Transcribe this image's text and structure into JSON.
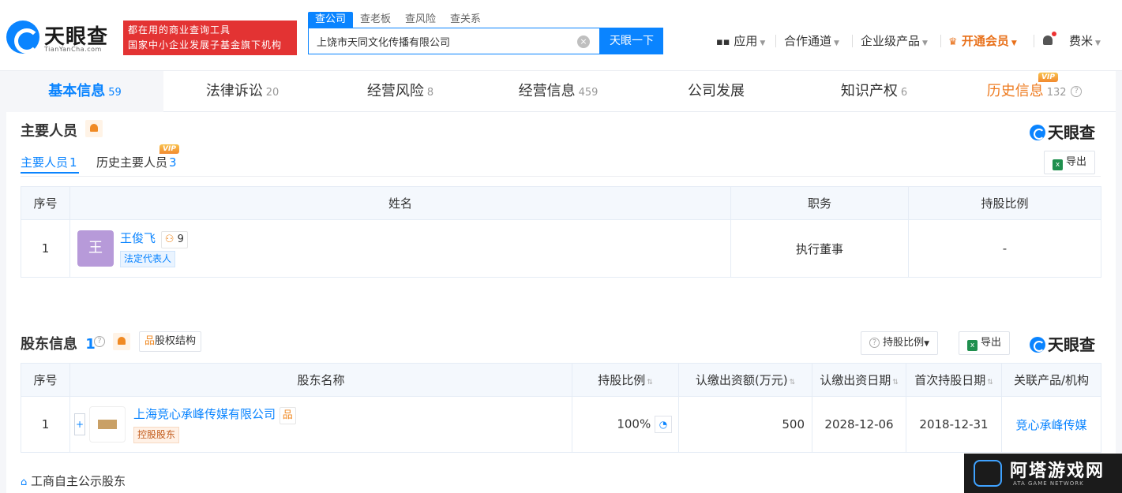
{
  "header": {
    "logo_text": "天眼查",
    "logo_sub": "TianYanCha.com",
    "slogan_line1": "都在用的商业查询工具",
    "slogan_line2": "国家中小企业发展子基金旗下机构",
    "search_tabs": [
      "查公司",
      "查老板",
      "查风险",
      "查关系"
    ],
    "search_value": "上饶市天同文化传播有限公司",
    "search_button": "天眼一下",
    "nav": {
      "apps": "应用",
      "channel": "合作通道",
      "enterprise": "企业级产品",
      "vip": "开通会员",
      "user": "费米"
    }
  },
  "tabs": [
    {
      "label": "基本信息",
      "count": "59"
    },
    {
      "label": "法律诉讼",
      "count": "20"
    },
    {
      "label": "经营风险",
      "count": "8"
    },
    {
      "label": "经营信息",
      "count": "459"
    },
    {
      "label": "公司发展",
      "count": ""
    },
    {
      "label": "知识产权",
      "count": "6"
    },
    {
      "label": "历史信息",
      "count": "132"
    }
  ],
  "vip_badge": "VIP",
  "brand_mark": "天眼查",
  "personnel": {
    "title": "主要人员",
    "subtabs": [
      {
        "label": "主要人员",
        "count": "1"
      },
      {
        "label": "历史主要人员",
        "count": "3"
      }
    ],
    "export": "导出",
    "columns": [
      "序号",
      "姓名",
      "职务",
      "持股比例"
    ],
    "rows": [
      {
        "index": "1",
        "avatar": "王",
        "name": "王俊飞",
        "relation_count": "9",
        "tag": "法定代表人",
        "position": "执行董事",
        "share": "-"
      }
    ]
  },
  "shareholders": {
    "title": "股东信息",
    "count": "1",
    "structure_button": "股权结构",
    "ratio_button": "持股比例",
    "export": "导出",
    "columns": [
      "序号",
      "股东名称",
      "持股比例",
      "认缴出资额(万元)",
      "认缴出资日期",
      "首次持股日期",
      "关联产品/机构"
    ],
    "rows": [
      {
        "index": "1",
        "name": "上海竞心承峰传媒有限公司",
        "tag": "控股股东",
        "share": "100%",
        "amount": "500",
        "date": "2028-12-06",
        "first_date": "2018-12-31",
        "product": "竞心承峰传媒"
      }
    ],
    "footer_note": "工商自主公示股东"
  },
  "watermark_text": "阿塔游戏网",
  "watermark_sub": "ATA GAME NETWORK"
}
